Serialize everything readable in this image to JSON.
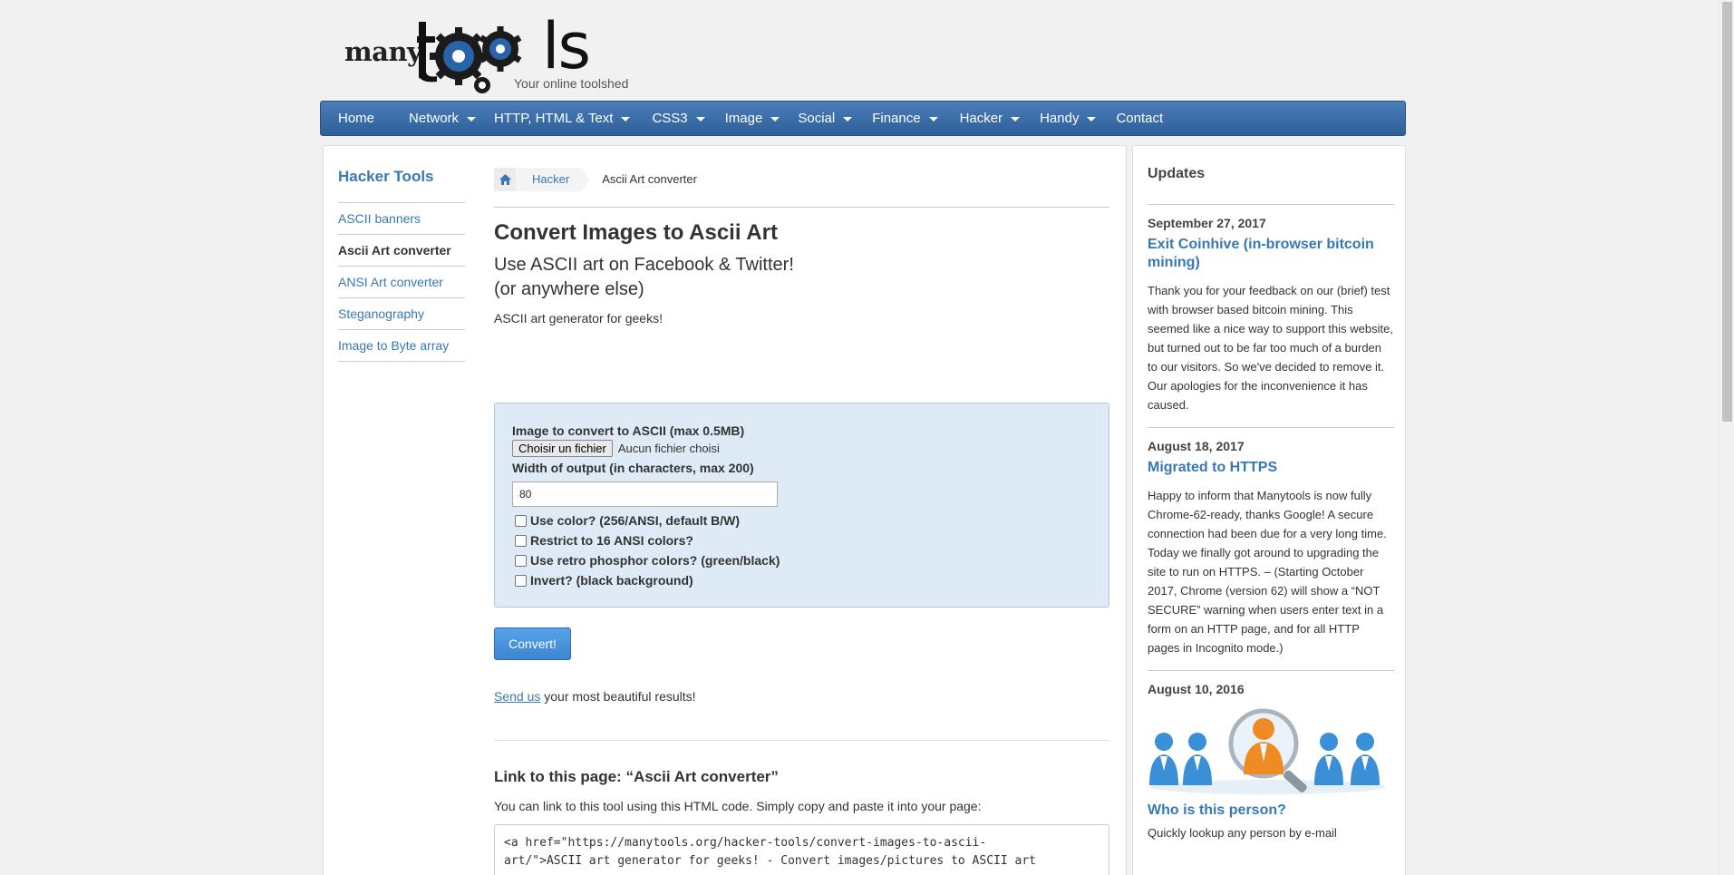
{
  "logo": {
    "many": "many",
    "ls": "ls",
    "tagline": "Your online toolshed"
  },
  "nav": [
    {
      "label": "Home",
      "dropdown": false
    },
    {
      "label": "Network",
      "dropdown": true
    },
    {
      "label": "HTTP, HTML & Text",
      "dropdown": true
    },
    {
      "label": "CSS3",
      "dropdown": true
    },
    {
      "label": "Image",
      "dropdown": true
    },
    {
      "label": "Social",
      "dropdown": true
    },
    {
      "label": "Finance",
      "dropdown": true
    },
    {
      "label": "Hacker",
      "dropdown": true
    },
    {
      "label": "Handy",
      "dropdown": true
    },
    {
      "label": "Contact",
      "dropdown": false
    }
  ],
  "sidebar": {
    "title": "Hacker Tools",
    "items": [
      {
        "label": "ASCII banners"
      },
      {
        "label": "Ascii Art converter"
      },
      {
        "label": "ANSI Art converter"
      },
      {
        "label": "Steganography"
      },
      {
        "label": "Image to Byte array"
      }
    ]
  },
  "breadcrumb": {
    "parent": "Hacker",
    "current": "Ascii Art converter"
  },
  "main": {
    "title": "Convert Images to Ascii Art",
    "subtitle_line1": "Use ASCII art on Facebook & Twitter!",
    "subtitle_line2": "(or anywhere else)",
    "description": "ASCII art generator for geeks!"
  },
  "form": {
    "image_label": "Image to convert to ASCII (max 0.5MB)",
    "file_button": "Choisir un fichier",
    "file_none": "Aucun fichier choisi",
    "width_label": "Width of output (in characters, max 200)",
    "width_value": "80",
    "opt_color": "Use color? (256/ANSI, default B/W)",
    "opt_ansi16": "Restrict to 16 ANSI colors?",
    "opt_retro": "Use retro phosphor colors? (green/black)",
    "opt_invert": "Invert? (black background)",
    "submit": "Convert!"
  },
  "send": {
    "link": "Send us",
    "rest": " your most beautiful results!"
  },
  "link_section": {
    "title": "Link to this page: “Ascii Art converter”",
    "desc": "You can link to this tool using this HTML code. Simply copy and paste it into your page:",
    "code_line1": "<a href=\"https://manytools.org/hacker-tools/convert-images-to-ascii-",
    "code_line2": "art/\">ASCII art generator for geeks! - Convert images/pictures to ASCII art"
  },
  "updates": {
    "title": "Updates",
    "items": [
      {
        "date": "September 27, 2017",
        "headline": "Exit Coinhive (in-browser bitcoin mining)",
        "text": "Thank you for your feedback on our (brief) test with browser based bitcoin mining. This seemed like a nice way to support this website, but turned out to be far too much of a burden to our visitors. So we've decided to remove it. Our apologies for the inconvenience it has caused."
      },
      {
        "date": "August 18, 2017",
        "headline": "Migrated to HTTPS",
        "text": "Happy to inform that Manytools is now fully Chrome-62-ready, thanks Google! A secure connection had been due for a very long time. Today we finally got around to upgrading the site to run on HTTPS. – (Starting October 2017, Chrome (version 62) will show a “NOT SECURE” warning when users enter text in a form on an HTTP page, and for all HTTP pages in Incognito mode.)"
      },
      {
        "date": "August 10, 2016",
        "headline": "Who is this person?",
        "text": "Quickly lookup any person by e-mail"
      }
    ]
  },
  "colors": {
    "link": "#3778b5",
    "nav_top": "#4a7dba",
    "nav_bottom": "#2e5f98",
    "form_bg": "#deebf7",
    "button": "#3c86d2"
  }
}
